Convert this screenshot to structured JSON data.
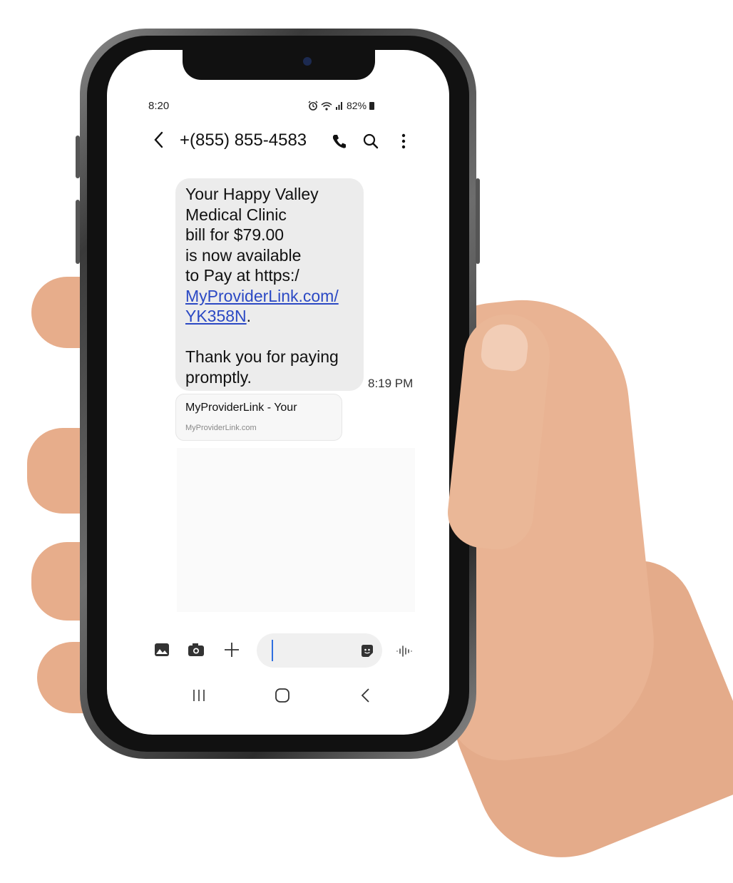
{
  "status_bar": {
    "time": "8:20",
    "battery": "82%"
  },
  "header": {
    "contact": "+(855) 855-4583"
  },
  "message": {
    "lines": [
      "Your Happy Valley",
      "Medical Clinic",
      "bill for $79.00",
      "is now available",
      "to Pay at https:/"
    ],
    "link_lines": [
      "MyProviderLink.com/",
      "YK358N"
    ],
    "link_suffix": ".",
    "closing_lines": [
      "Thank you for paying",
      "promptly."
    ],
    "time": "8:19 PM"
  },
  "link_preview": {
    "title": "MyProviderLink - Your",
    "domain": "MyProviderLink.com"
  },
  "compose": {
    "placeholder": ""
  },
  "colors": {
    "link": "#2b49c4",
    "bubble": "#ececec",
    "caret": "#2f6fe0"
  },
  "icons": [
    "back-icon",
    "phone-icon",
    "search-icon",
    "more-icon",
    "gallery-icon",
    "camera-icon",
    "add-icon",
    "sticker-icon",
    "voice-icon",
    "recents-icon",
    "home-icon",
    "nav-back-icon"
  ]
}
